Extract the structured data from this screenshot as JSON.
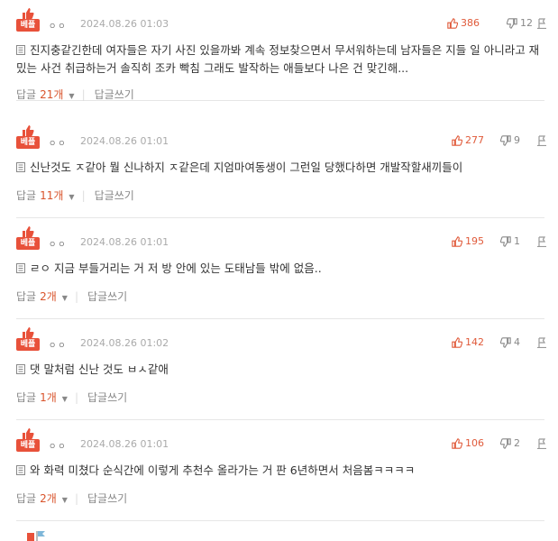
{
  "comments": [
    {
      "badge": "베플",
      "author": "ㅇㅇ",
      "date": "2024.08.26 01:03",
      "likes": "386",
      "dislikes": "12",
      "text": "진지충같긴한데 여자들은 자기 사진 있을까봐 계속 정보찾으면서 무서워하는데 남자들은 지들 일 아니라고 재밌는 사건 취급하는거 솔직히 조카 빡침 그래도 발작하는 애들보다 나은 건 맞긴해...",
      "reply_label": "답글",
      "reply_count": "21개",
      "write_label": "답글쓰기"
    },
    {
      "badge": "베플",
      "author": "ㅇㅇ",
      "date": "2024.08.26 01:01",
      "likes": "277",
      "dislikes": "9",
      "text": "신난것도 ㅈ같아 뭘 신나하지 ㅈ같은데 지엄마여동생이 그런일 당했다하면 개발작할새끼들이",
      "reply_label": "답글",
      "reply_count": "11개",
      "write_label": "답글쓰기"
    },
    {
      "badge": "베플",
      "author": "ㅇㅇ",
      "date": "2024.08.26 01:01",
      "likes": "195",
      "dislikes": "1",
      "text": "ㄹㅇ 지금 부들거리는 거 저 방 안에 있는 도태남들 밖에 없음..",
      "reply_label": "답글",
      "reply_count": "2개",
      "write_label": "답글쓰기"
    },
    {
      "badge": "베플",
      "author": "ㅇㅇ",
      "date": "2024.08.26 01:02",
      "likes": "142",
      "dislikes": "4",
      "text": "댓 말처럼 신난 것도 ㅂㅅ같애",
      "reply_label": "답글",
      "reply_count": "1개",
      "write_label": "답글쓰기"
    },
    {
      "badge": "베플",
      "author": "ㅇㅇ",
      "date": "2024.08.26 01:01",
      "likes": "106",
      "dislikes": "2",
      "text": "와 화력 미쳤다 순식간에 이렇게 추천수 올라가는 거 판 6년하면서 처음봄ㅋㅋㅋㅋ",
      "reply_label": "답글",
      "reply_count": "2개",
      "write_label": "답글쓰기"
    }
  ],
  "colors": {
    "badge_bg": "#e8513a",
    "likes": "#e05a3a",
    "reply_count": "#d9542c"
  }
}
